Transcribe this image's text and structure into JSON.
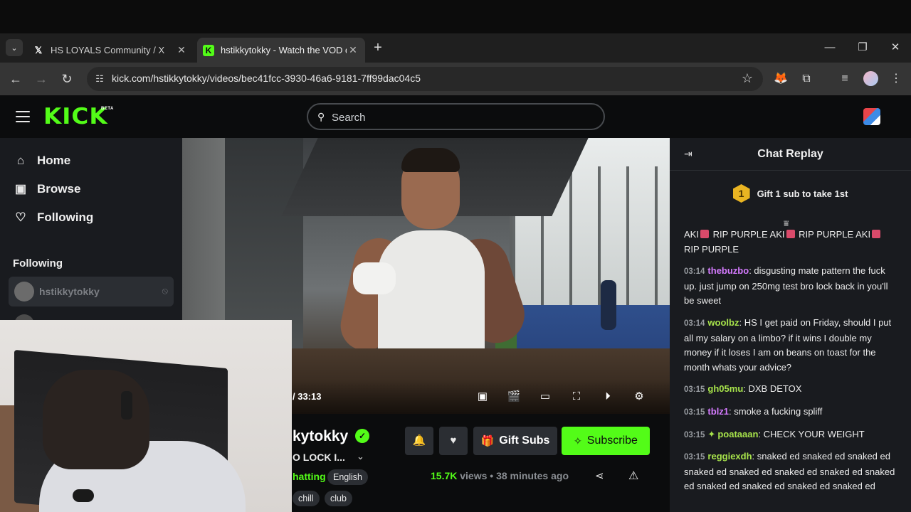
{
  "browser": {
    "tabs": [
      {
        "label": "HS LOYALS Community / X",
        "favicon": "x-logo-icon"
      },
      {
        "label": "hstikkytokky - Watch the VOD d",
        "favicon": "kick-logo-icon"
      }
    ],
    "url": "kick.com/hstikkytokky/videos/bec41fcc-3930-46a6-9181-7ff99dac04c5"
  },
  "kick": {
    "logo": "KICK",
    "beta": "BETA",
    "search_placeholder": "Search",
    "accent": "#53fc18"
  },
  "sidebar": {
    "nav": [
      {
        "label": "Home",
        "icon": "home-icon"
      },
      {
        "label": "Browse",
        "icon": "browse-icon"
      },
      {
        "label": "Following",
        "icon": "heart-icon"
      }
    ],
    "following_heading": "Following",
    "following_channel": "hstikkytokky"
  },
  "video": {
    "time": "/ 33:13"
  },
  "stream": {
    "channel_name": "kytokky",
    "title": "O LOCK I...",
    "category": "hatting",
    "tags": [
      "English",
      "chill",
      "club"
    ],
    "views_count": "15.7K",
    "views_label": " views",
    "separator": " • ",
    "age": "38 minutes ago",
    "gift_label": "Gift Subs",
    "subscribe_label": "Subscribe"
  },
  "chat": {
    "title": "Chat Replay",
    "gift_banner": "Gift 1 sub to take 1st",
    "rank": "1",
    "messages": [
      {
        "ts": "",
        "user": "",
        "color": "",
        "text_parts": [
          "AKI",
          "RIP PURPLE AKI",
          "RIP PURPLE AKI",
          "RIP PURPLE"
        ]
      },
      {
        "ts": "03:14",
        "user": "thebuzbo",
        "color": "#d57bff",
        "text": "disgusting mate pattern the fuck up. just jump on 250mg test bro lock back in you'll be sweet"
      },
      {
        "ts": "03:14",
        "user": "woolbz",
        "color": "#a7e34b",
        "text": "HS I get paid on Friday, should I put all my salary on a limbo? if it wins I double my money if it loses I am on beans on toast for the month whats your advice?"
      },
      {
        "ts": "03:15",
        "user": "gh05mu",
        "color": "#a7e34b",
        "text": "DXB DETOX"
      },
      {
        "ts": "03:15",
        "user": "tblz1",
        "color": "#d57bff",
        "text": "smoke a fucking spliff"
      },
      {
        "ts": "03:15",
        "user": "poataaan",
        "color": "#a7e34b",
        "text": "CHECK YOUR WEIGHT"
      },
      {
        "ts": "03:15",
        "user": "reggiexdh",
        "color": "#a7e34b",
        "text": "snaked ed snaked ed snaked ed snaked ed snaked ed snaked ed snaked ed snaked ed snaked ed snaked ed snaked ed snaked ed"
      }
    ]
  }
}
